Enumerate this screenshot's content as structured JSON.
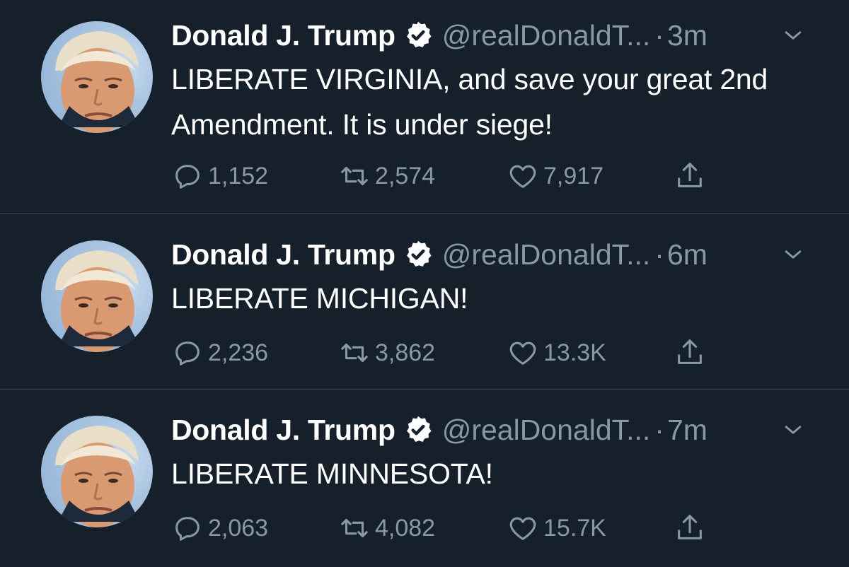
{
  "theme": {
    "background": "#15202b",
    "divider": "#38444d",
    "text_primary": "#ffffff",
    "text_secondary": "#8899a6"
  },
  "tweets": [
    {
      "name": "Donald J. Trump",
      "handle": "@realDonaldT...",
      "separator": "·",
      "time": "3m",
      "text": "LIBERATE VIRGINIA, and save your great 2nd Amendment. It is under siege!",
      "replies": "1,152",
      "retweets": "2,574",
      "likes": "7,917"
    },
    {
      "name": "Donald J. Trump",
      "handle": "@realDonaldT...",
      "separator": "·",
      "time": "6m",
      "text": "LIBERATE MICHIGAN!",
      "replies": "2,236",
      "retweets": "3,862",
      "likes": "13.3K"
    },
    {
      "name": "Donald J. Trump",
      "handle": "@realDonaldT...",
      "separator": "·",
      "time": "7m",
      "text": "LIBERATE MINNESOTA!",
      "replies": "2,063",
      "retweets": "4,082",
      "likes": "15.7K"
    }
  ],
  "icons": {
    "verified": "verified-badge-icon",
    "menu": "chevron-down-icon",
    "reply": "reply-icon",
    "retweet": "retweet-icon",
    "like": "heart-icon",
    "share": "share-icon"
  }
}
